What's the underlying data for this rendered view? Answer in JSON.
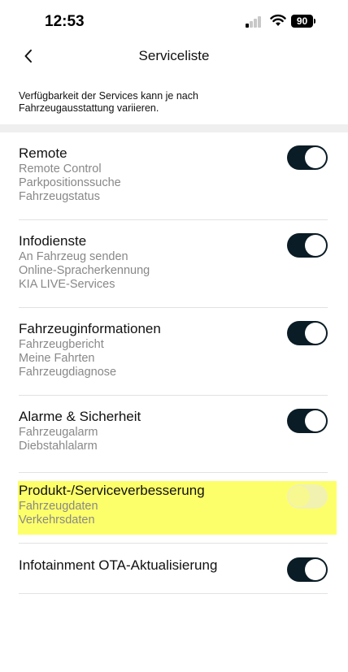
{
  "status_bar": {
    "time": "12:53",
    "battery": "90"
  },
  "header": {
    "title": "Serviceliste"
  },
  "info_text": "Verfügbarkeit der Services kann je nach Fahrzeugausstattung variieren.",
  "services": [
    {
      "title": "Remote",
      "items": [
        "Remote Control",
        "Parkpositionssuche",
        "Fahrzeugstatus"
      ],
      "enabled": true
    },
    {
      "title": "Infodienste",
      "items": [
        "An Fahrzeug senden",
        "Online-Spracherkennung",
        "KIA LIVE-Services"
      ],
      "enabled": true
    },
    {
      "title": "Fahrzeuginformationen",
      "items": [
        "Fahrzeugbericht",
        "Meine Fahrten",
        "Fahrzeugdiagnose"
      ],
      "enabled": true
    },
    {
      "title": "Alarme & Sicherheit",
      "items": [
        "Fahrzeugalarm",
        "Diebstahlalarm"
      ],
      "enabled": true
    },
    {
      "title": "Produkt-/Serviceverbesserung",
      "items": [
        "Fahrzeugdaten",
        "Verkehrsdaten"
      ],
      "enabled": false
    },
    {
      "title": "Infotainment OTA-Aktualisierung",
      "items": [],
      "enabled": true
    }
  ],
  "colors": {
    "toggle_on": "#0a1c25",
    "toggle_off": "#e9e9ea",
    "highlight": "#fdff6a",
    "subtext": "#888888"
  },
  "icons": {
    "back": "chevron-left-icon",
    "signal": "cellular-signal-icon",
    "wifi": "wifi-icon",
    "battery": "battery-icon"
  }
}
